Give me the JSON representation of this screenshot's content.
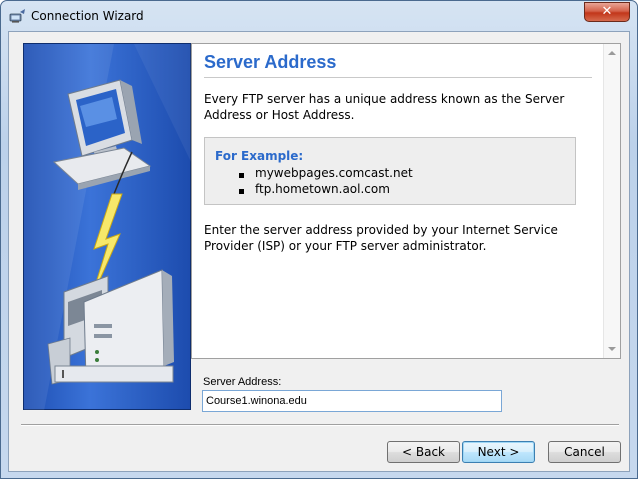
{
  "window": {
    "title": "Connection Wizard",
    "close_glyph": "✕"
  },
  "page": {
    "title": "Server Address",
    "intro": "Every FTP server has a unique address known as the Server Address or Host Address.",
    "example": {
      "heading": "For Example:",
      "items": [
        "mywebpages.comcast.net",
        "ftp.hometown.aol.com"
      ]
    },
    "instructions": "Enter the server address provided by your Internet Service Provider (ISP) or your FTP server administrator."
  },
  "form": {
    "server_address_label": "Server Address:",
    "server_address_value": "Course1.winona.edu"
  },
  "buttons": {
    "back": "< Back",
    "next": "Next >",
    "cancel": "Cancel"
  },
  "icons": {
    "app": "ftp-connection-icon",
    "side_illustration": "computer-to-server-connection-illustration",
    "scroll_up": "scroll-up-arrow-icon",
    "scroll_down": "scroll-down-arrow-icon"
  },
  "colors": {
    "accent_blue": "#2b6acb",
    "side_panel_blue": "#1e4fb3",
    "close_red": "#c2361a"
  }
}
